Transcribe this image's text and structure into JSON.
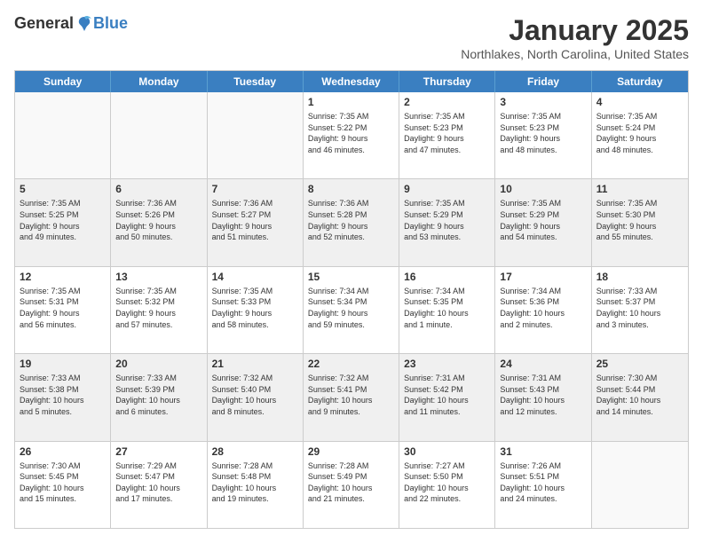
{
  "header": {
    "logo_general": "General",
    "logo_blue": "Blue",
    "month_title": "January 2025",
    "location": "Northlakes, North Carolina, United States"
  },
  "weekdays": [
    "Sunday",
    "Monday",
    "Tuesday",
    "Wednesday",
    "Thursday",
    "Friday",
    "Saturday"
  ],
  "rows": [
    [
      {
        "day": "",
        "info": ""
      },
      {
        "day": "",
        "info": ""
      },
      {
        "day": "",
        "info": ""
      },
      {
        "day": "1",
        "info": "Sunrise: 7:35 AM\nSunset: 5:22 PM\nDaylight: 9 hours\nand 46 minutes."
      },
      {
        "day": "2",
        "info": "Sunrise: 7:35 AM\nSunset: 5:23 PM\nDaylight: 9 hours\nand 47 minutes."
      },
      {
        "day": "3",
        "info": "Sunrise: 7:35 AM\nSunset: 5:23 PM\nDaylight: 9 hours\nand 48 minutes."
      },
      {
        "day": "4",
        "info": "Sunrise: 7:35 AM\nSunset: 5:24 PM\nDaylight: 9 hours\nand 48 minutes."
      }
    ],
    [
      {
        "day": "5",
        "info": "Sunrise: 7:35 AM\nSunset: 5:25 PM\nDaylight: 9 hours\nand 49 minutes."
      },
      {
        "day": "6",
        "info": "Sunrise: 7:36 AM\nSunset: 5:26 PM\nDaylight: 9 hours\nand 50 minutes."
      },
      {
        "day": "7",
        "info": "Sunrise: 7:36 AM\nSunset: 5:27 PM\nDaylight: 9 hours\nand 51 minutes."
      },
      {
        "day": "8",
        "info": "Sunrise: 7:36 AM\nSunset: 5:28 PM\nDaylight: 9 hours\nand 52 minutes."
      },
      {
        "day": "9",
        "info": "Sunrise: 7:35 AM\nSunset: 5:29 PM\nDaylight: 9 hours\nand 53 minutes."
      },
      {
        "day": "10",
        "info": "Sunrise: 7:35 AM\nSunset: 5:29 PM\nDaylight: 9 hours\nand 54 minutes."
      },
      {
        "day": "11",
        "info": "Sunrise: 7:35 AM\nSunset: 5:30 PM\nDaylight: 9 hours\nand 55 minutes."
      }
    ],
    [
      {
        "day": "12",
        "info": "Sunrise: 7:35 AM\nSunset: 5:31 PM\nDaylight: 9 hours\nand 56 minutes."
      },
      {
        "day": "13",
        "info": "Sunrise: 7:35 AM\nSunset: 5:32 PM\nDaylight: 9 hours\nand 57 minutes."
      },
      {
        "day": "14",
        "info": "Sunrise: 7:35 AM\nSunset: 5:33 PM\nDaylight: 9 hours\nand 58 minutes."
      },
      {
        "day": "15",
        "info": "Sunrise: 7:34 AM\nSunset: 5:34 PM\nDaylight: 9 hours\nand 59 minutes."
      },
      {
        "day": "16",
        "info": "Sunrise: 7:34 AM\nSunset: 5:35 PM\nDaylight: 10 hours\nand 1 minute."
      },
      {
        "day": "17",
        "info": "Sunrise: 7:34 AM\nSunset: 5:36 PM\nDaylight: 10 hours\nand 2 minutes."
      },
      {
        "day": "18",
        "info": "Sunrise: 7:33 AM\nSunset: 5:37 PM\nDaylight: 10 hours\nand 3 minutes."
      }
    ],
    [
      {
        "day": "19",
        "info": "Sunrise: 7:33 AM\nSunset: 5:38 PM\nDaylight: 10 hours\nand 5 minutes."
      },
      {
        "day": "20",
        "info": "Sunrise: 7:33 AM\nSunset: 5:39 PM\nDaylight: 10 hours\nand 6 minutes."
      },
      {
        "day": "21",
        "info": "Sunrise: 7:32 AM\nSunset: 5:40 PM\nDaylight: 10 hours\nand 8 minutes."
      },
      {
        "day": "22",
        "info": "Sunrise: 7:32 AM\nSunset: 5:41 PM\nDaylight: 10 hours\nand 9 minutes."
      },
      {
        "day": "23",
        "info": "Sunrise: 7:31 AM\nSunset: 5:42 PM\nDaylight: 10 hours\nand 11 minutes."
      },
      {
        "day": "24",
        "info": "Sunrise: 7:31 AM\nSunset: 5:43 PM\nDaylight: 10 hours\nand 12 minutes."
      },
      {
        "day": "25",
        "info": "Sunrise: 7:30 AM\nSunset: 5:44 PM\nDaylight: 10 hours\nand 14 minutes."
      }
    ],
    [
      {
        "day": "26",
        "info": "Sunrise: 7:30 AM\nSunset: 5:45 PM\nDaylight: 10 hours\nand 15 minutes."
      },
      {
        "day": "27",
        "info": "Sunrise: 7:29 AM\nSunset: 5:47 PM\nDaylight: 10 hours\nand 17 minutes."
      },
      {
        "day": "28",
        "info": "Sunrise: 7:28 AM\nSunset: 5:48 PM\nDaylight: 10 hours\nand 19 minutes."
      },
      {
        "day": "29",
        "info": "Sunrise: 7:28 AM\nSunset: 5:49 PM\nDaylight: 10 hours\nand 21 minutes."
      },
      {
        "day": "30",
        "info": "Sunrise: 7:27 AM\nSunset: 5:50 PM\nDaylight: 10 hours\nand 22 minutes."
      },
      {
        "day": "31",
        "info": "Sunrise: 7:26 AM\nSunset: 5:51 PM\nDaylight: 10 hours\nand 24 minutes."
      },
      {
        "day": "",
        "info": ""
      }
    ]
  ]
}
